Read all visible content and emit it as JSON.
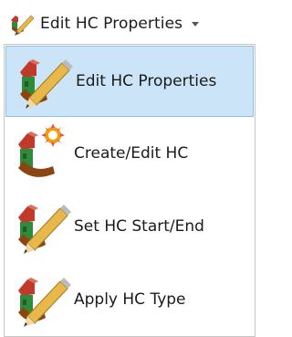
{
  "toolbar": {
    "button_label": "Edit HC Properties",
    "button_icon": "edit-pencil-icon"
  },
  "menu": {
    "items": [
      {
        "label": "Edit HC Properties",
        "icon": "edit-pencil-icon",
        "selected": true
      },
      {
        "label": "Create/Edit HC",
        "icon": "create-hc-icon",
        "selected": false
      },
      {
        "label": "Set HC Start/End",
        "icon": "set-start-end-icon",
        "selected": false
      },
      {
        "label": "Apply HC Type",
        "icon": "apply-type-icon",
        "selected": false
      }
    ]
  },
  "colors": {
    "selected_bg": "#cce4f7",
    "selected_border": "#91c0e6",
    "pencil_yellow": "#e8b84a",
    "roof_red": "#c0392b",
    "wall_green": "#2e8b3a",
    "bent_brown": "#8b4513",
    "burst_orange": "#f39c12"
  }
}
